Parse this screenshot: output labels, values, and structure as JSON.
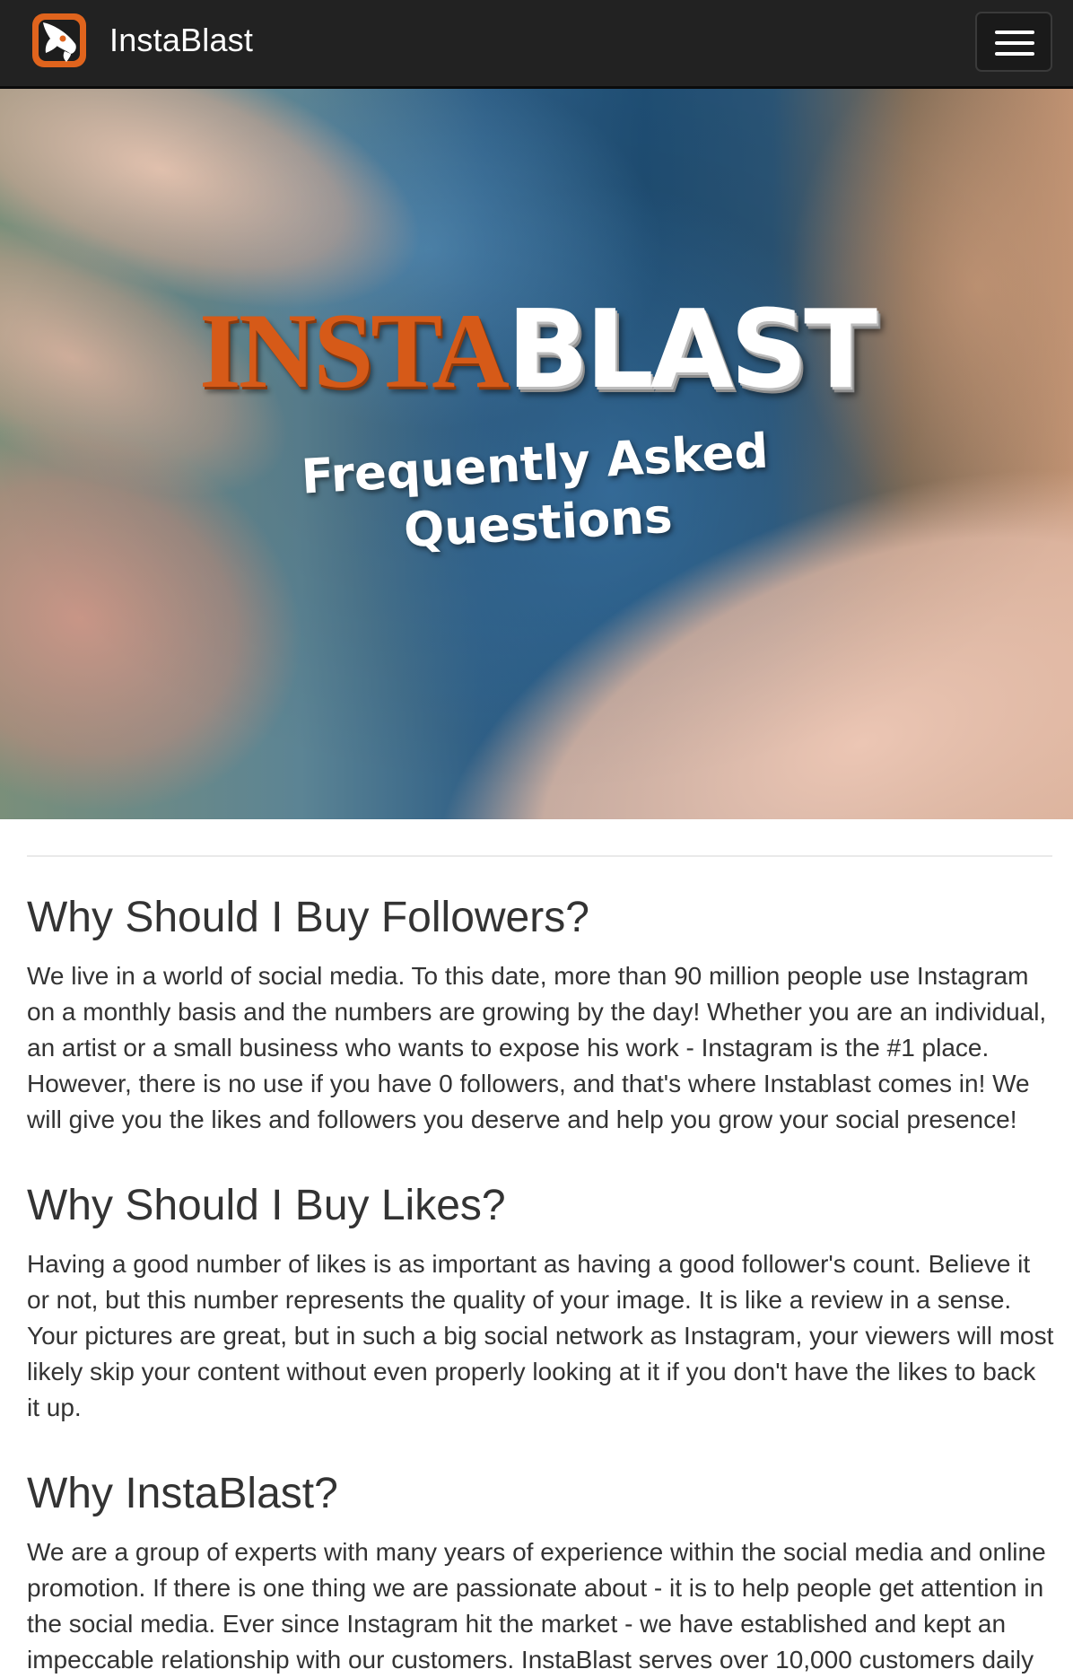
{
  "navbar": {
    "brand_name": "InstaBlast",
    "logo_icon": "rocket-icon",
    "menu_icon": "hamburger-menu-icon"
  },
  "hero": {
    "title_part1": "INSTA",
    "title_part2": "BLAST",
    "subtitle": "Frequently Asked Questions"
  },
  "faq": [
    {
      "heading": "Why Should I Buy Followers?",
      "text": "We live in a world of social media. To this date, more than 90 million people use Instagram on a monthly basis and the numbers are growing by the day! Whether you are an individual, an artist or a small business who wants to expose his work - Instagram is the #1 place. However, there is no use if you have 0 followers, and that's where Instablast comes in! We will give you the likes and followers you deserve and help you grow your social presence!"
    },
    {
      "heading": "Why Should I Buy Likes?",
      "text": "Having a good number of likes is as important as having a good follower's count. Believe it or not, but this number represents the quality of your image. It is like a review in a sense. Your pictures are great, but in such a big social network as Instagram, your viewers will most likely skip your content without even properly looking at it if you don't have the likes to back it up."
    },
    {
      "heading": "Why InstaBlast?",
      "text": "We are a group of experts with many years of experience within the social media and online promotion. If there is one thing we are passionate about - it is to help people get attention in the social media. Ever since Instagram hit the market - we have established and kept an impeccable relationship with our customers. InstaBlast serves over 10,000 customers daily"
    }
  ],
  "colors": {
    "navbar_bg": "#222222",
    "brand_orange": "#d65a18",
    "text": "#333333"
  }
}
